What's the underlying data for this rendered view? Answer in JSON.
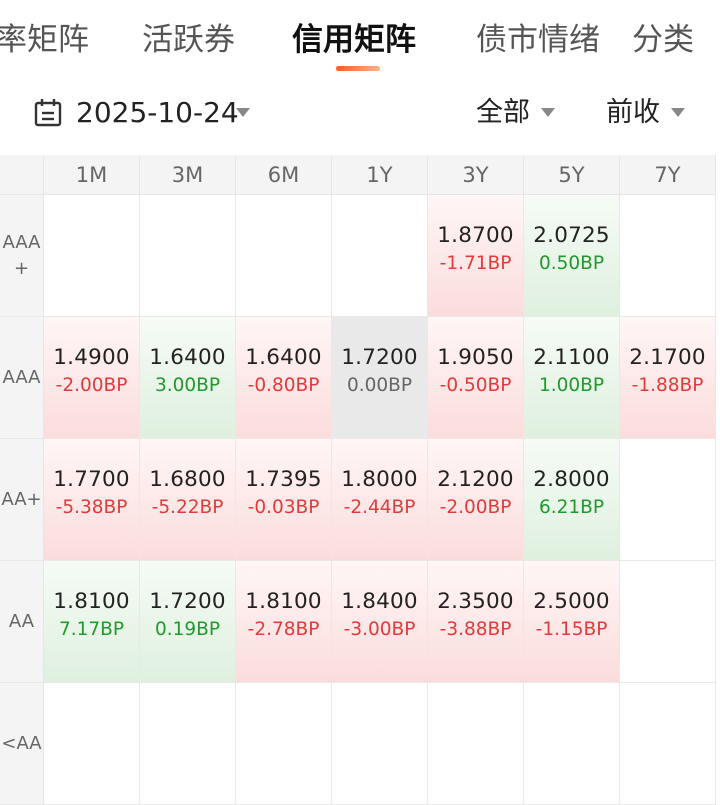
{
  "tabs": [
    {
      "label": "率矩阵",
      "active": false
    },
    {
      "label": "活跃券",
      "active": false
    },
    {
      "label": "信用矩阵",
      "active": true
    },
    {
      "label": "债市情绪",
      "active": false
    },
    {
      "label": "分类",
      "active": false
    }
  ],
  "filter": {
    "date": "2025-10-24",
    "scope": "全部",
    "compare": "前收",
    "icons": {
      "calendar": "calendar-icon",
      "caret": "chevron-down-icon"
    }
  },
  "colors": {
    "up": "#e23b3b",
    "down": "#1f9a2c",
    "flat": "#666666",
    "accent": "#ff5a2a"
  },
  "matrix": {
    "columns": [
      "1M",
      "3M",
      "6M",
      "1Y",
      "3Y",
      "5Y",
      "7Y"
    ],
    "rows": [
      {
        "label": "AAA\n+",
        "cells": [
          null,
          null,
          null,
          null,
          {
            "value": "1.8700",
            "change": "-1.71BP",
            "trend": "red"
          },
          {
            "value": "2.0725",
            "change": "0.50BP",
            "trend": "green"
          },
          null
        ]
      },
      {
        "label": "AAA",
        "cells": [
          {
            "value": "1.4900",
            "change": "-2.00BP",
            "trend": "red"
          },
          {
            "value": "1.6400",
            "change": "3.00BP",
            "trend": "green"
          },
          {
            "value": "1.6400",
            "change": "-0.80BP",
            "trend": "red"
          },
          {
            "value": "1.7200",
            "change": "0.00BP",
            "trend": "gray"
          },
          {
            "value": "1.9050",
            "change": "-0.50BP",
            "trend": "red"
          },
          {
            "value": "2.1100",
            "change": "1.00BP",
            "trend": "green"
          },
          {
            "value": "2.1700",
            "change": "-1.88BP",
            "trend": "red"
          }
        ]
      },
      {
        "label": "AA+",
        "cells": [
          {
            "value": "1.7700",
            "change": "-5.38BP",
            "trend": "red"
          },
          {
            "value": "1.6800",
            "change": "-5.22BP",
            "trend": "red"
          },
          {
            "value": "1.7395",
            "change": "-0.03BP",
            "trend": "red"
          },
          {
            "value": "1.8000",
            "change": "-2.44BP",
            "trend": "red"
          },
          {
            "value": "2.1200",
            "change": "-2.00BP",
            "trend": "red"
          },
          {
            "value": "2.8000",
            "change": "6.21BP",
            "trend": "green"
          },
          null
        ]
      },
      {
        "label": "AA",
        "cells": [
          {
            "value": "1.8100",
            "change": "7.17BP",
            "trend": "green"
          },
          {
            "value": "1.7200",
            "change": "0.19BP",
            "trend": "green"
          },
          {
            "value": "1.8100",
            "change": "-2.78BP",
            "trend": "red"
          },
          {
            "value": "1.8400",
            "change": "-3.00BP",
            "trend": "red"
          },
          {
            "value": "2.3500",
            "change": "-3.88BP",
            "trend": "red"
          },
          {
            "value": "2.5000",
            "change": "-1.15BP",
            "trend": "red"
          },
          null
        ]
      },
      {
        "label": "<AA",
        "cells": [
          null,
          null,
          null,
          null,
          null,
          null,
          null
        ]
      }
    ]
  }
}
